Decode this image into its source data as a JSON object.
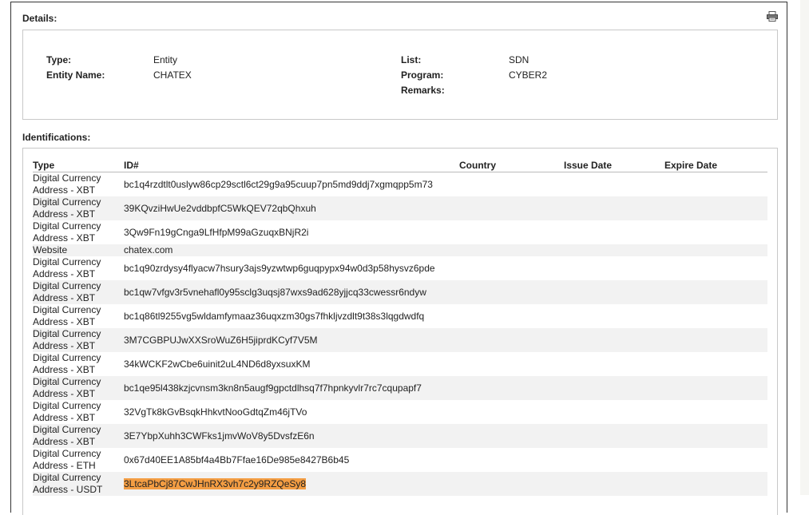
{
  "details": {
    "title": "Details:",
    "type_label": "Type:",
    "type_value": "Entity",
    "entity_name_label": "Entity Name:",
    "entity_name_value": "CHATEX",
    "list_label": "List:",
    "list_value": "SDN",
    "program_label": "Program:",
    "program_value": "CYBER2",
    "remarks_label": "Remarks:",
    "remarks_value": ""
  },
  "identifications": {
    "title": "Identifications:",
    "headers": {
      "type": "Type",
      "id": "ID#",
      "country": "Country",
      "issue_date": "Issue Date",
      "expire_date": "Expire Date"
    },
    "rows": [
      {
        "type1": "Digital Currency",
        "type2": "Address - XBT",
        "id": "bc1q4rzdtlt0uslyw86cp29sctl6ct29g9a95cuup7pn5md9ddj7xgmqpp5m73"
      },
      {
        "type1": "Digital Currency",
        "type2": "Address - XBT",
        "id": "39KQvziHwUe2vddbpfC5WkQEV72qbQhxuh"
      },
      {
        "type1": "Digital Currency",
        "type2": "Address - XBT",
        "id": "3Qw9Fn19gCnga9LfHfpM99aGzuqxBNjR2i"
      },
      {
        "type1": "Website",
        "type2": "",
        "id": "chatex.com"
      },
      {
        "type1": "Digital Currency",
        "type2": "Address - XBT",
        "id": "bc1q90zrdysy4flyacw7hsury3ajs9yzwtwp6guqpypx94w0d3p58hysvz6pde"
      },
      {
        "type1": "Digital Currency",
        "type2": "Address - XBT",
        "id": "bc1qw7vfgv3r5vnehafl0y95sclg3uqsj87wxs9ad628yjjcq33cwessr6ndyw"
      },
      {
        "type1": "Digital Currency",
        "type2": "Address - XBT",
        "id": "bc1q86tl9255vg5wldamfymaaz36uqxzm30gs7fhkljvzdlt9t38s3lqgdwdfq"
      },
      {
        "type1": "Digital Currency",
        "type2": "Address - XBT",
        "id": "3M7CGBPUJwXXSroWuZ6H5jiprdKCyf7V5M"
      },
      {
        "type1": "Digital Currency",
        "type2": "Address - XBT",
        "id": "34kWCKF2wCbe6uinit2uL4ND6d8yxsuxKM"
      },
      {
        "type1": "Digital Currency",
        "type2": "Address - XBT",
        "id": "bc1qe95l438kzjcvnsm3kn8n5augf9gpctdlhsq7f7hpnkyvlr7rc7cqupapf7"
      },
      {
        "type1": "Digital Currency",
        "type2": "Address - XBT",
        "id": "32VgTk8kGvBsqkHhkvtNooGdtqZm46jTVo"
      },
      {
        "type1": "Digital Currency",
        "type2": "Address - XBT",
        "id": "3E7YbpXuhh3CWFks1jmvWoV8y5DvsfzE6n"
      },
      {
        "type1": "Digital Currency",
        "type2": "Address - ETH",
        "id": "0x67d40EE1A85bf4a4Bb7Ffae16De985e8427B6b45"
      },
      {
        "type1": "Digital Currency",
        "type2": "Address - USDT",
        "id": "3LtcaPbCj87CwJHnRX3vh7c2y9RZQeSy8"
      }
    ]
  },
  "colors": {
    "highlight": "#f39d43",
    "alt_row": "#f2f2f2"
  }
}
